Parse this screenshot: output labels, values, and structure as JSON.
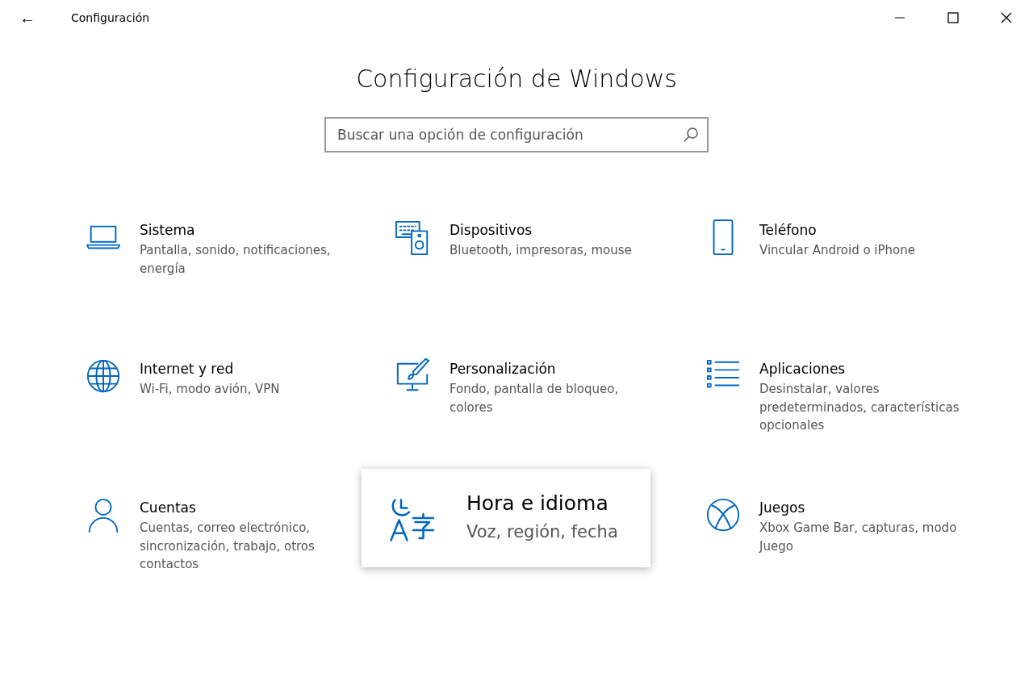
{
  "window": {
    "back": "←",
    "title": "Configuración"
  },
  "heading": "Configuración de Windows",
  "search": {
    "placeholder": "Buscar una opción de configuración"
  },
  "categories": [
    {
      "title": "Sistema",
      "description": "Pantalla, sonido, notificaciones, energía",
      "selected": false
    },
    {
      "title": "Dispositivos",
      "description": "Bluetooth, impresoras, mouse",
      "selected": false
    },
    {
      "title": "Teléfono",
      "description": "Vincular Android o iPhone",
      "selected": false
    },
    {
      "title": "Internet y red",
      "description": "Wi-Fi, modo avión, VPN",
      "selected": false
    },
    {
      "title": "Personalización",
      "description": "Fondo, pantalla de bloqueo, colores",
      "selected": false
    },
    {
      "title": "Aplicaciones",
      "description": "Desinstalar, valores predeterminados, características opcionales",
      "selected": false
    },
    {
      "title": "Cuentas",
      "description": "Cuentas, correo electrónico, sincronización, trabajo, otros contactos",
      "selected": false
    },
    {
      "title": "Hora e idioma",
      "description": "Voz, región, fecha",
      "selected": true
    },
    {
      "title": "Juegos",
      "description": "Xbox Game Bar, capturas, modo Juego",
      "selected": false
    }
  ]
}
